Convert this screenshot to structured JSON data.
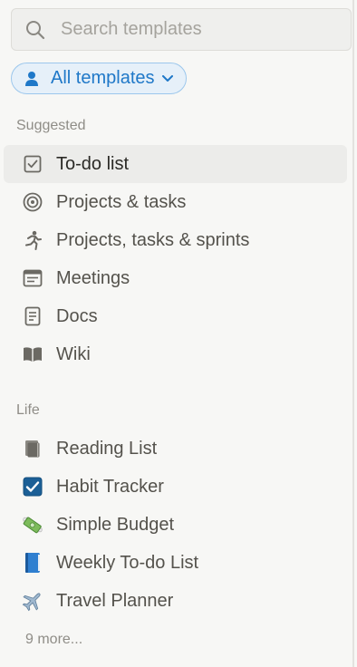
{
  "search": {
    "placeholder": "Search templates",
    "icon": "search-icon"
  },
  "filter": {
    "label": "All templates",
    "icon": "person-icon",
    "dropdown_icon": "chevron-down-icon",
    "accent_color": "#1f78c8"
  },
  "sections": [
    {
      "label": "Suggested",
      "items": [
        {
          "label": "To-do list",
          "icon": "checkbox-icon",
          "active": true
        },
        {
          "label": "Projects & tasks",
          "icon": "target-icon"
        },
        {
          "label": "Projects, tasks & sprints",
          "icon": "running-person-icon"
        },
        {
          "label": "Meetings",
          "icon": "calendar-icon"
        },
        {
          "label": "Docs",
          "icon": "document-icon"
        },
        {
          "label": "Wiki",
          "icon": "open-book-icon"
        }
      ]
    },
    {
      "label": "Life",
      "items": [
        {
          "label": "Reading List",
          "icon": "books-icon"
        },
        {
          "label": "Habit Tracker",
          "icon": "check-mark-button-icon"
        },
        {
          "label": "Simple Budget",
          "icon": "money-with-wings-icon"
        },
        {
          "label": "Weekly To-do List",
          "icon": "blue-book-icon"
        },
        {
          "label": "Travel Planner",
          "icon": "airplane-icon"
        }
      ]
    }
  ],
  "more_link": "9 more..."
}
